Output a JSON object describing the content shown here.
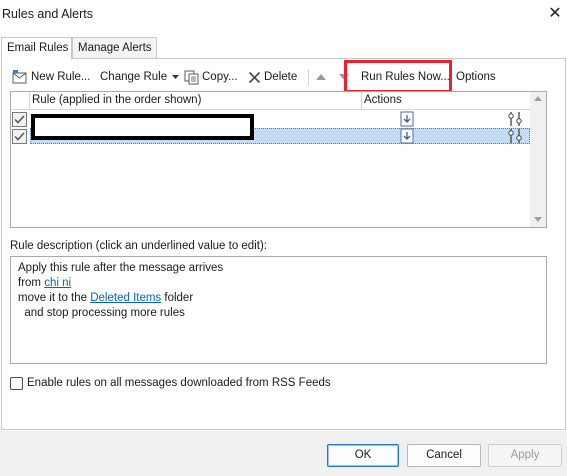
{
  "window": {
    "title": "Rules and Alerts",
    "close_glyph": "✕"
  },
  "tabs": [
    {
      "label": "Email Rules",
      "active": true
    },
    {
      "label": "Manage Alerts",
      "active": false
    }
  ],
  "toolbar": {
    "new_rule": "New Rule...",
    "change_rule": "Change Rule",
    "copy": "Copy...",
    "delete": "Delete",
    "run_rules_now": "Run Rules Now...",
    "options": "Options",
    "move_up_icon": "triangle-up-icon",
    "move_down_icon": "triangle-down-icon"
  },
  "rules_list": {
    "columns": {
      "rule": "Rule (applied in the order shown)",
      "actions": "Actions"
    },
    "rows": [
      {
        "name": "",
        "checked": true,
        "selected": false
      },
      {
        "name": "",
        "checked": true,
        "selected": true
      }
    ]
  },
  "description": {
    "label": "Rule description (click an underlined value to edit):",
    "line1": "Apply this rule after the message arrives",
    "line2_prefix": "from ",
    "line2_link": "chi ni",
    "line3_prefix": "move it to the ",
    "line3_link": "Deleted Items",
    "line3_suffix": " folder",
    "line4": "  and stop processing more rules"
  },
  "rss": {
    "label": "Enable rules on all messages downloaded from RSS Feeds",
    "checked": false
  },
  "buttons": {
    "ok": "OK",
    "cancel": "Cancel",
    "apply": "Apply"
  },
  "colors": {
    "highlight_box": "#e8232b",
    "selected_row": "#c3dcf4",
    "link": "#0563c1"
  }
}
